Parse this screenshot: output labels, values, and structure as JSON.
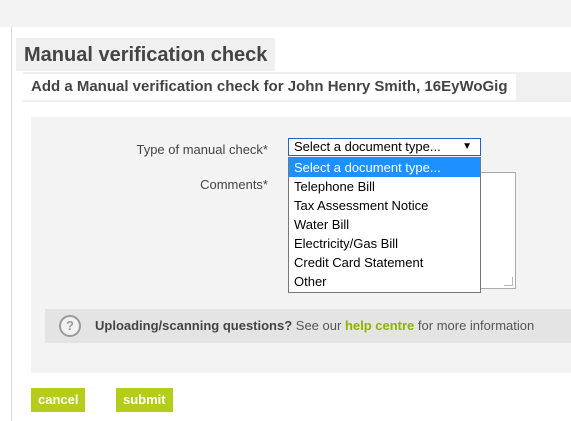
{
  "page": {
    "title": "Manual verification check",
    "subtitle": "Add a Manual verification check for John Henry Smith, 16EyWoGig"
  },
  "form": {
    "type_label": "Type of manual check*",
    "comments_label": "Comments*",
    "select_value": "Select a document type...",
    "dropdown_options": [
      "Select a document type...",
      "Telephone Bill",
      "Tax Assessment Notice",
      "Water Bill",
      "Electricity/Gas Bill",
      "Credit Card Statement",
      "Other"
    ]
  },
  "info": {
    "question": "Uploading/scanning questions?",
    "text_before": " See our ",
    "link": "help centre",
    "text_after": " for more information"
  },
  "buttons": {
    "cancel": "cancel",
    "submit": "submit"
  },
  "colors": {
    "accent": "#b5cc18",
    "link": "#8db400",
    "selection": "#1e90ff",
    "panel": "#f3f3f3"
  }
}
